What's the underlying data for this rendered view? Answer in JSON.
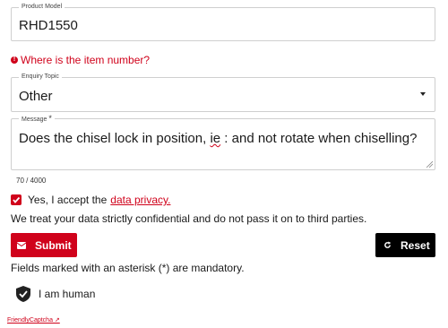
{
  "form": {
    "product_model": {
      "label": "Product Model",
      "value": "RHD1550"
    },
    "error": {
      "icon": "error-circle-icon",
      "text": "Where is the item number?"
    },
    "enquiry_topic": {
      "label": "Enquiry Topic",
      "value": "Other"
    },
    "message": {
      "label": "Message",
      "required_mark": "*",
      "value_before": "Does the chisel lock in position, ",
      "value_flagged": "ie",
      "value_after": " : and not rotate when chiselling?"
    },
    "counter": "70 / 4000",
    "privacy": {
      "checked": true,
      "prefix": "Yes, I accept the",
      "link": "data privacy."
    },
    "confidential_notice": "We treat your data strictly confidential and do not pass it on to third parties.",
    "buttons": {
      "submit": "Submit",
      "reset": "Reset"
    },
    "mandatory_notice": "Fields marked with an asterisk (*) are mandatory.",
    "captcha": {
      "label": "I am human",
      "link": "FriendlyCaptcha ↗"
    }
  },
  "colors": {
    "accent": "#d0021b",
    "dark": "#000000",
    "border": "#cfcfcf"
  }
}
